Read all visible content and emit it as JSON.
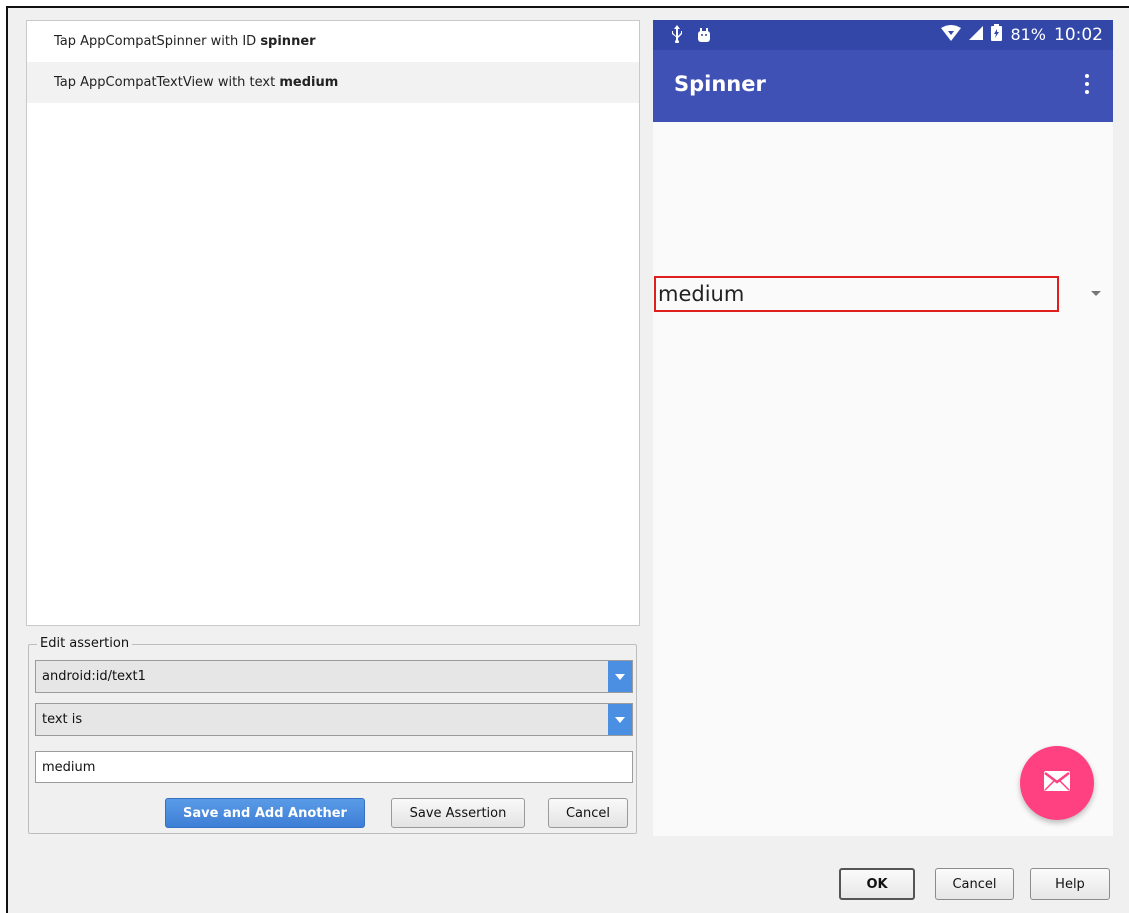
{
  "events": [
    {
      "prefix": "Tap AppCompatSpinner with ID ",
      "bold": "spinner"
    },
    {
      "prefix": "Tap AppCompatTextView with text ",
      "bold": "medium"
    }
  ],
  "assertion": {
    "legend": "Edit assertion",
    "view_select": "android:id/text1",
    "condition_select": "text is",
    "value": "medium",
    "save_add_label": "Save and Add Another",
    "save_label": "Save Assertion",
    "cancel_label": "Cancel"
  },
  "device": {
    "battery": "81%",
    "time": "10:02",
    "app_title": "Spinner",
    "spinner_value": "medium",
    "colors": {
      "statusbar": "#3247a8",
      "appbar": "#3f51b5",
      "fab": "#ff4081",
      "highlight": "#e01e1e"
    },
    "icons": [
      "usb-icon",
      "android-icon",
      "wifi-icon",
      "signal-icon",
      "battery-icon",
      "overflow-menu-icon",
      "email-icon"
    ]
  },
  "footer": {
    "ok_label": "OK",
    "cancel_label": "Cancel",
    "help_label": "Help"
  },
  "colors": {
    "primary_button": "#3d7fd6"
  }
}
